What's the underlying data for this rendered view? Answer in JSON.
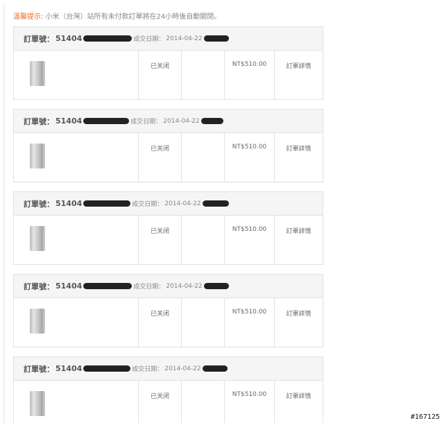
{
  "notice": {
    "label": "溫馨提示:",
    "text": "小米（台灣）站所有未付款訂單將在24小時後自動關閉。"
  },
  "orders": [
    {
      "order_label": "訂單號：",
      "order_number": "51404",
      "date_label": "成交日期：",
      "date": "2014-04-22",
      "status": "已关闭",
      "price": "NT$510.00",
      "detail_link": "訂單詳情"
    },
    {
      "order_label": "訂單號：",
      "order_number": "51404",
      "date_label": "成交日期：",
      "date": "2014-04-22",
      "status": "已关闭",
      "price": "NT$510.00",
      "detail_link": "訂單詳情"
    },
    {
      "order_label": "訂單號：",
      "order_number": "51404",
      "date_label": "成交日期：",
      "date": "2014-04-22",
      "status": "已关闭",
      "price": "NT$510.00",
      "detail_link": "訂單詳情"
    },
    {
      "order_label": "訂單號：",
      "order_number": "51404",
      "date_label": "成交日期：",
      "date": "2014-04-22",
      "status": "已关闭",
      "price": "NT$510.00",
      "detail_link": "訂單詳情"
    },
    {
      "order_label": "訂單號：",
      "order_number": "51404",
      "date_label": "成交日期：",
      "date": "2014-04-22",
      "status": "已关闭",
      "price": "NT$510.00",
      "detail_link": "訂單詳情"
    }
  ],
  "watermark": "#167125",
  "colors": {
    "accent": "#f06c1c",
    "border": "#e0e0e0",
    "header_bg": "#f5f5f5"
  }
}
